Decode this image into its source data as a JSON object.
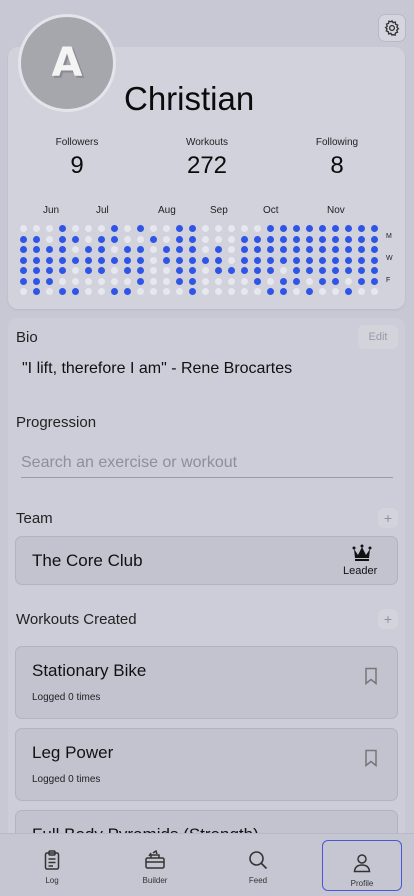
{
  "profile": {
    "name": "Christian",
    "avatar_letter": "A",
    "stats": [
      {
        "label": "Followers",
        "value": "9"
      },
      {
        "label": "Workouts",
        "value": "272"
      },
      {
        "label": "Following",
        "value": "8"
      }
    ]
  },
  "activity": {
    "months": [
      "Jun",
      "Jul",
      "Aug",
      "Sep",
      "Oct",
      "Nov"
    ],
    "day_labels": [
      "M",
      "W",
      "F"
    ],
    "active_color": "#2f55e6",
    "inactive_color": "#e7e7ef"
  },
  "bio": {
    "title": "Bio",
    "edit_label": "Edit",
    "text": "\"I lift, therefore I am\" - Rene Brocartes"
  },
  "progression": {
    "title": "Progression",
    "search_placeholder": "Search an exercise or workout"
  },
  "team": {
    "title": "Team",
    "add_label": "+",
    "name": "The Core Club",
    "role": "Leader"
  },
  "workouts": {
    "title": "Workouts Created",
    "add_label": "+",
    "items": [
      {
        "name": "Stationary Bike",
        "meta": "Logged 0 times"
      },
      {
        "name": "Leg Power",
        "meta": "Logged 0 times"
      },
      {
        "name": "Full Body Pyramids (Strength)",
        "meta": ""
      }
    ]
  },
  "tabbar": {
    "tabs": [
      {
        "label": "Log",
        "icon": "clipboard-icon"
      },
      {
        "label": "Builder",
        "icon": "toolbox-icon"
      },
      {
        "label": "Feed",
        "icon": "magnifier-icon"
      },
      {
        "label": "Profile",
        "icon": "person-icon"
      }
    ],
    "active": "Profile",
    "accent": "#4b55d8"
  }
}
